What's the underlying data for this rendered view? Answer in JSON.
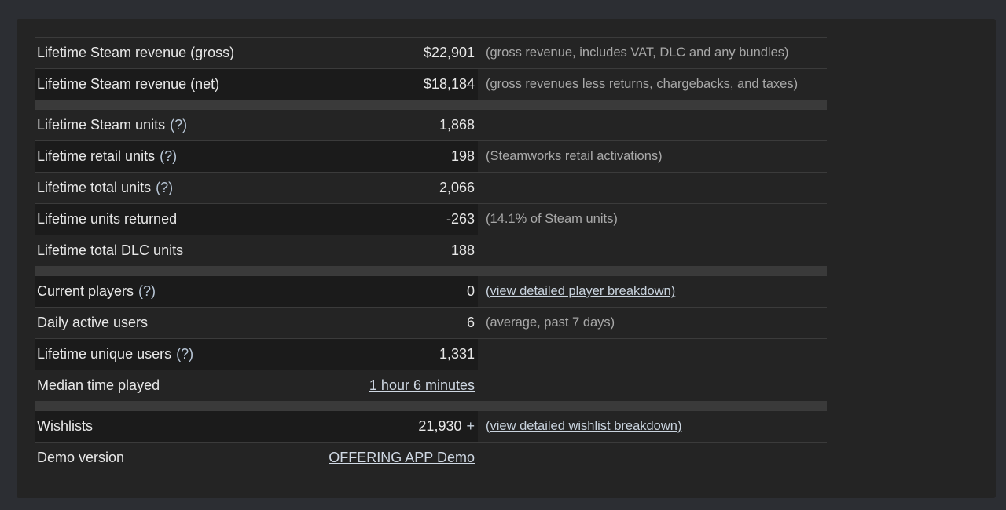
{
  "revenue": {
    "gross": {
      "label": "Lifetime Steam revenue (gross)",
      "value": "$22,901",
      "note": "(gross revenue, includes VAT, DLC and any bundles)"
    },
    "net": {
      "label": "Lifetime Steam revenue (net)",
      "value": "$18,184",
      "note": "(gross revenues less returns, chargebacks, and taxes)"
    }
  },
  "units": {
    "steam": {
      "label": "Lifetime Steam units",
      "help": "(?)",
      "value": "1,868"
    },
    "retail": {
      "label": "Lifetime retail units",
      "help": "(?)",
      "value": "198",
      "note": "(Steamworks retail activations)"
    },
    "total": {
      "label": "Lifetime total units",
      "help": "(?)",
      "value": "2,066"
    },
    "returned": {
      "label": "Lifetime units returned",
      "value": "-263",
      "note": "(14.1% of Steam units)"
    },
    "dlc": {
      "label": "Lifetime total DLC units",
      "value": "188"
    }
  },
  "players": {
    "current": {
      "label": "Current players",
      "help": "(?)",
      "value": "0",
      "link": "(view detailed player breakdown)"
    },
    "daily": {
      "label": "Daily active users",
      "value": "6",
      "note": "(average, past 7 days)"
    },
    "unique": {
      "label": "Lifetime unique users",
      "help": "(?)",
      "value": "1,331"
    },
    "median": {
      "label": "Median time played",
      "value": "1 hour 6 minutes"
    }
  },
  "wishlist": {
    "wishlists": {
      "label": "Wishlists",
      "value": "21,930",
      "plus": "+",
      "link": "(view detailed wishlist breakdown)"
    },
    "demo": {
      "label": "Demo version",
      "value": "OFFERING APP Demo"
    }
  }
}
